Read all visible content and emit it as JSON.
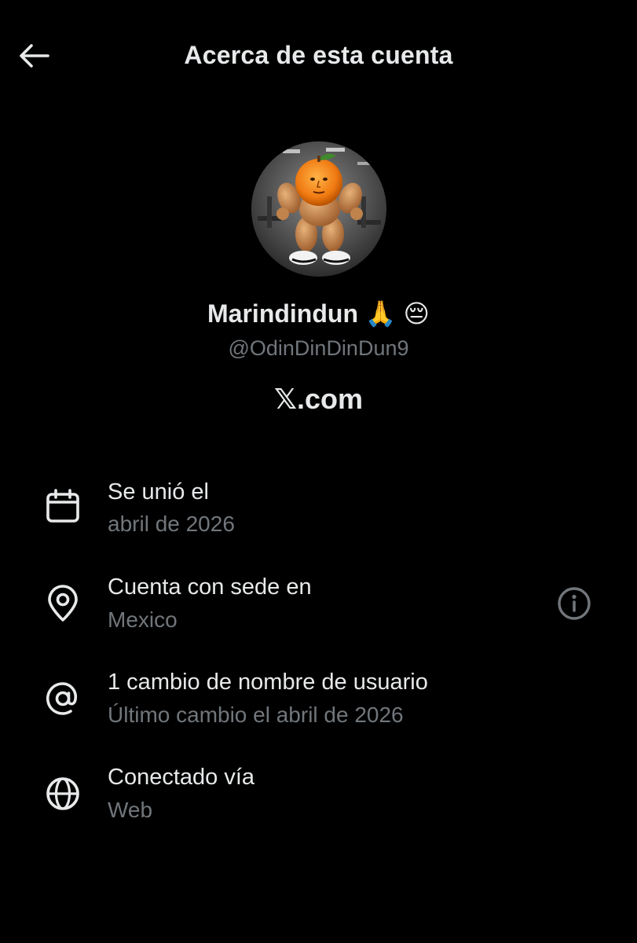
{
  "header": {
    "title": "Acerca de esta cuenta",
    "back_icon": "arrow-left-icon"
  },
  "profile": {
    "display_name": "Marindindun 🙏 😔",
    "handle": "@OdinDinDinDun9",
    "platform": "𝕏.com",
    "avatar_icon": "muscular-orange-avatar"
  },
  "rows": [
    {
      "icon": "calendar-icon",
      "title": "Se unió el",
      "subtitle": "abril de 2026"
    },
    {
      "icon": "location-pin-icon",
      "title": "Cuenta con sede en",
      "subtitle": "Mexico",
      "trailing_icon": "info-icon"
    },
    {
      "icon": "at-sign-icon",
      "title": "1 cambio de nombre de usuario",
      "subtitle": "Último cambio el abril de 2026"
    },
    {
      "icon": "globe-icon",
      "title": "Conectado vía",
      "subtitle": "Web"
    }
  ],
  "colors": {
    "background": "#000000",
    "text_primary": "#e7e9ea",
    "text_secondary": "#71767b"
  }
}
